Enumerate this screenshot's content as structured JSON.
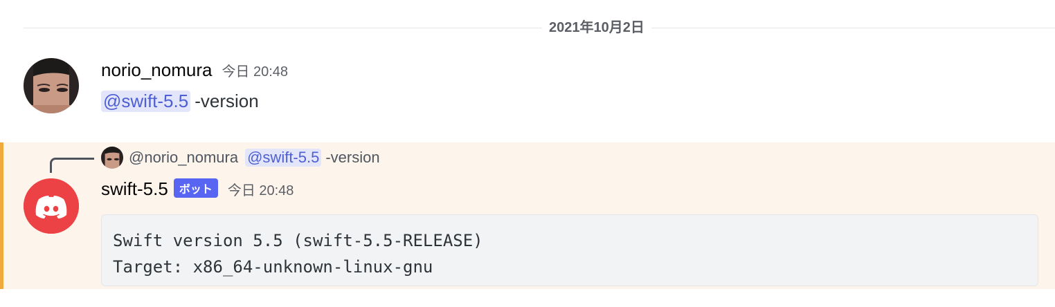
{
  "date_divider": {
    "label": "2021年10月2日"
  },
  "messages": [
    {
      "author": "norio_nomura",
      "timestamp": "今日 20:48",
      "mention": "@swift-5.5",
      "text": "-version"
    },
    {
      "author": "swift-5.5",
      "bot_badge": "ボット",
      "timestamp": "今日 20:48",
      "reply": {
        "author": "@norio_nomura",
        "mention": "@swift-5.5",
        "text": "-version"
      },
      "code_lines": [
        "Swift version 5.5 (swift-5.5-RELEASE)",
        "Target: x86_64-unknown-linux-gnu"
      ]
    }
  ],
  "colors": {
    "mention_bg": "#e3e6fb",
    "mention_text": "#4e5fd3",
    "bot_badge": "#5865f2",
    "highlight_bg": "#fdf5eb",
    "highlight_bar": "#f0a93b",
    "bot_avatar": "#ed4245"
  },
  "icons": {
    "bot_avatar": "discord-logo-icon",
    "user_avatar": "user-photo"
  }
}
